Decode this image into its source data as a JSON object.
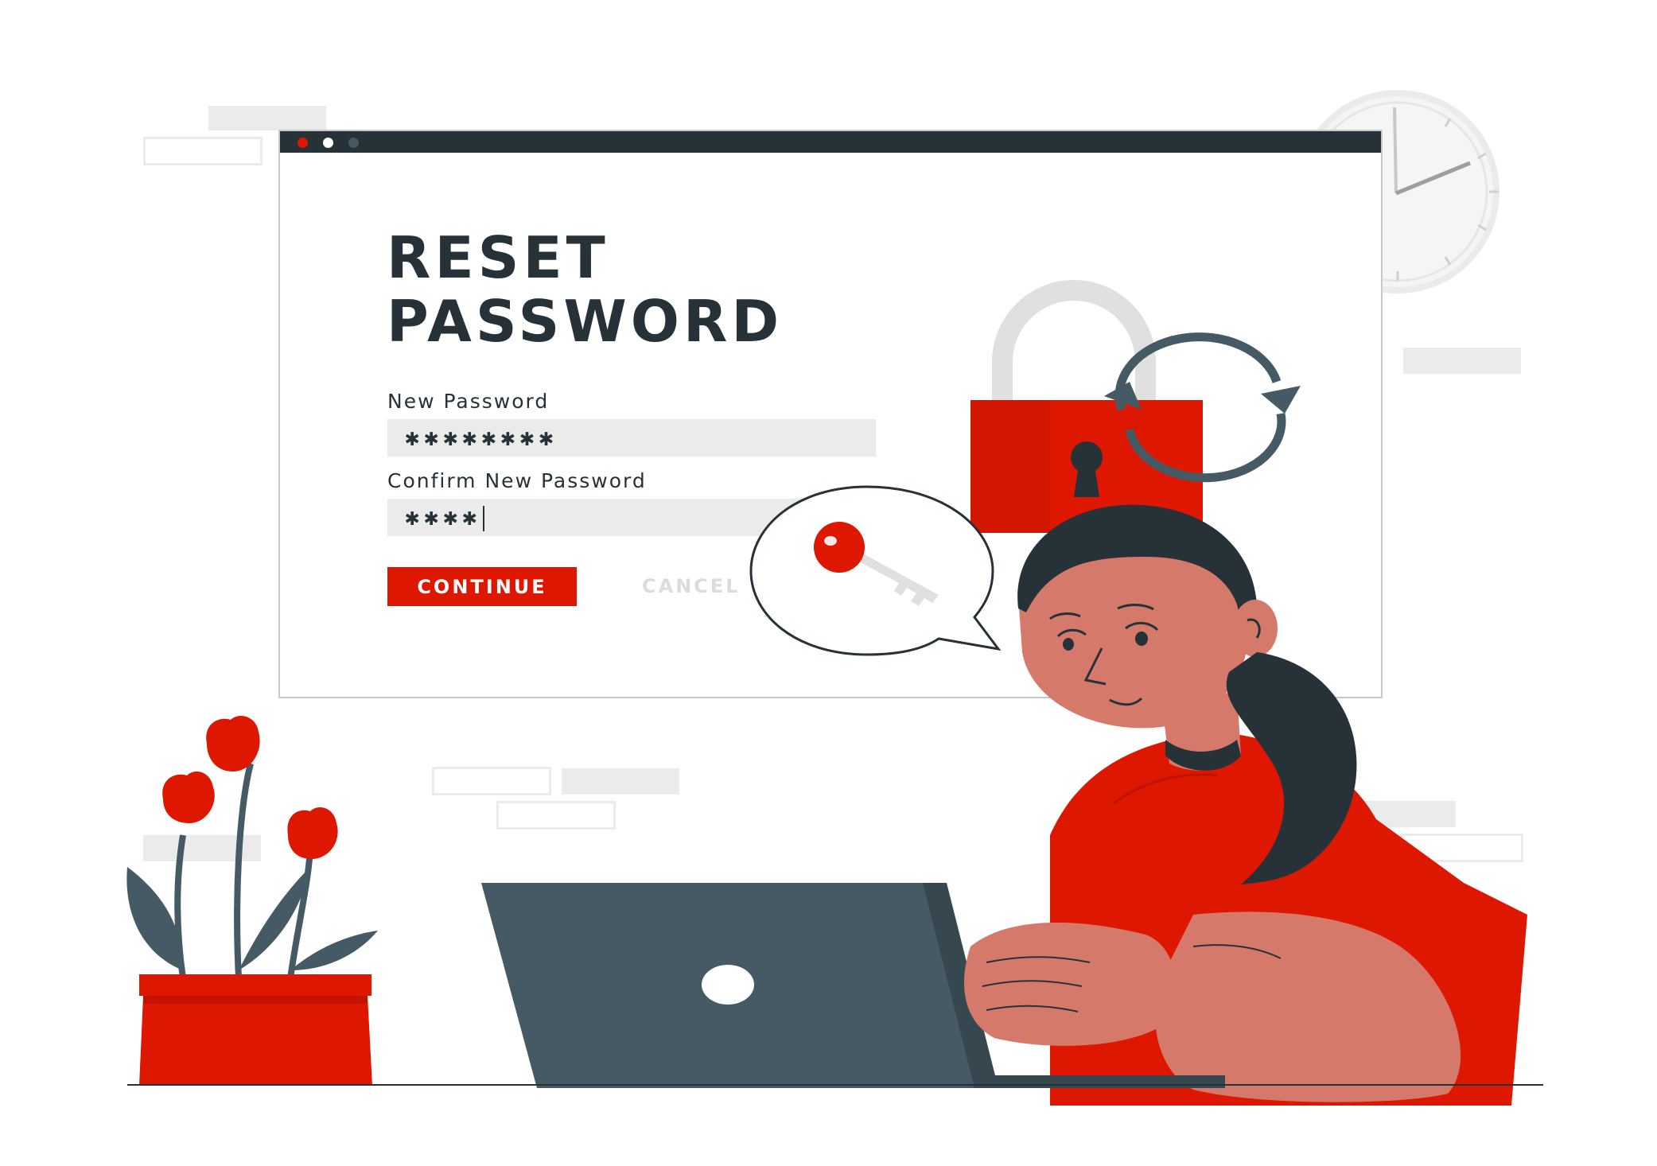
{
  "form": {
    "title_line1": "RESET",
    "title_line2": "PASSWORD",
    "new_password_label": "New Password",
    "new_password_value": "✱✱✱✱✱✱✱✱",
    "confirm_password_label": "Confirm New Password",
    "confirm_password_value": "✱✱✱✱",
    "continue_label": "CONTINUE",
    "cancel_label": "CANCEL"
  },
  "colors": {
    "accent": "#dd1700",
    "dark": "#263238",
    "laptop": "#455a64",
    "skin": "#d57a6a",
    "placeholder_gray": "#ebebeb"
  },
  "icons": [
    "padlock-icon",
    "refresh-arrows-icon",
    "key-icon",
    "clock-icon"
  ]
}
